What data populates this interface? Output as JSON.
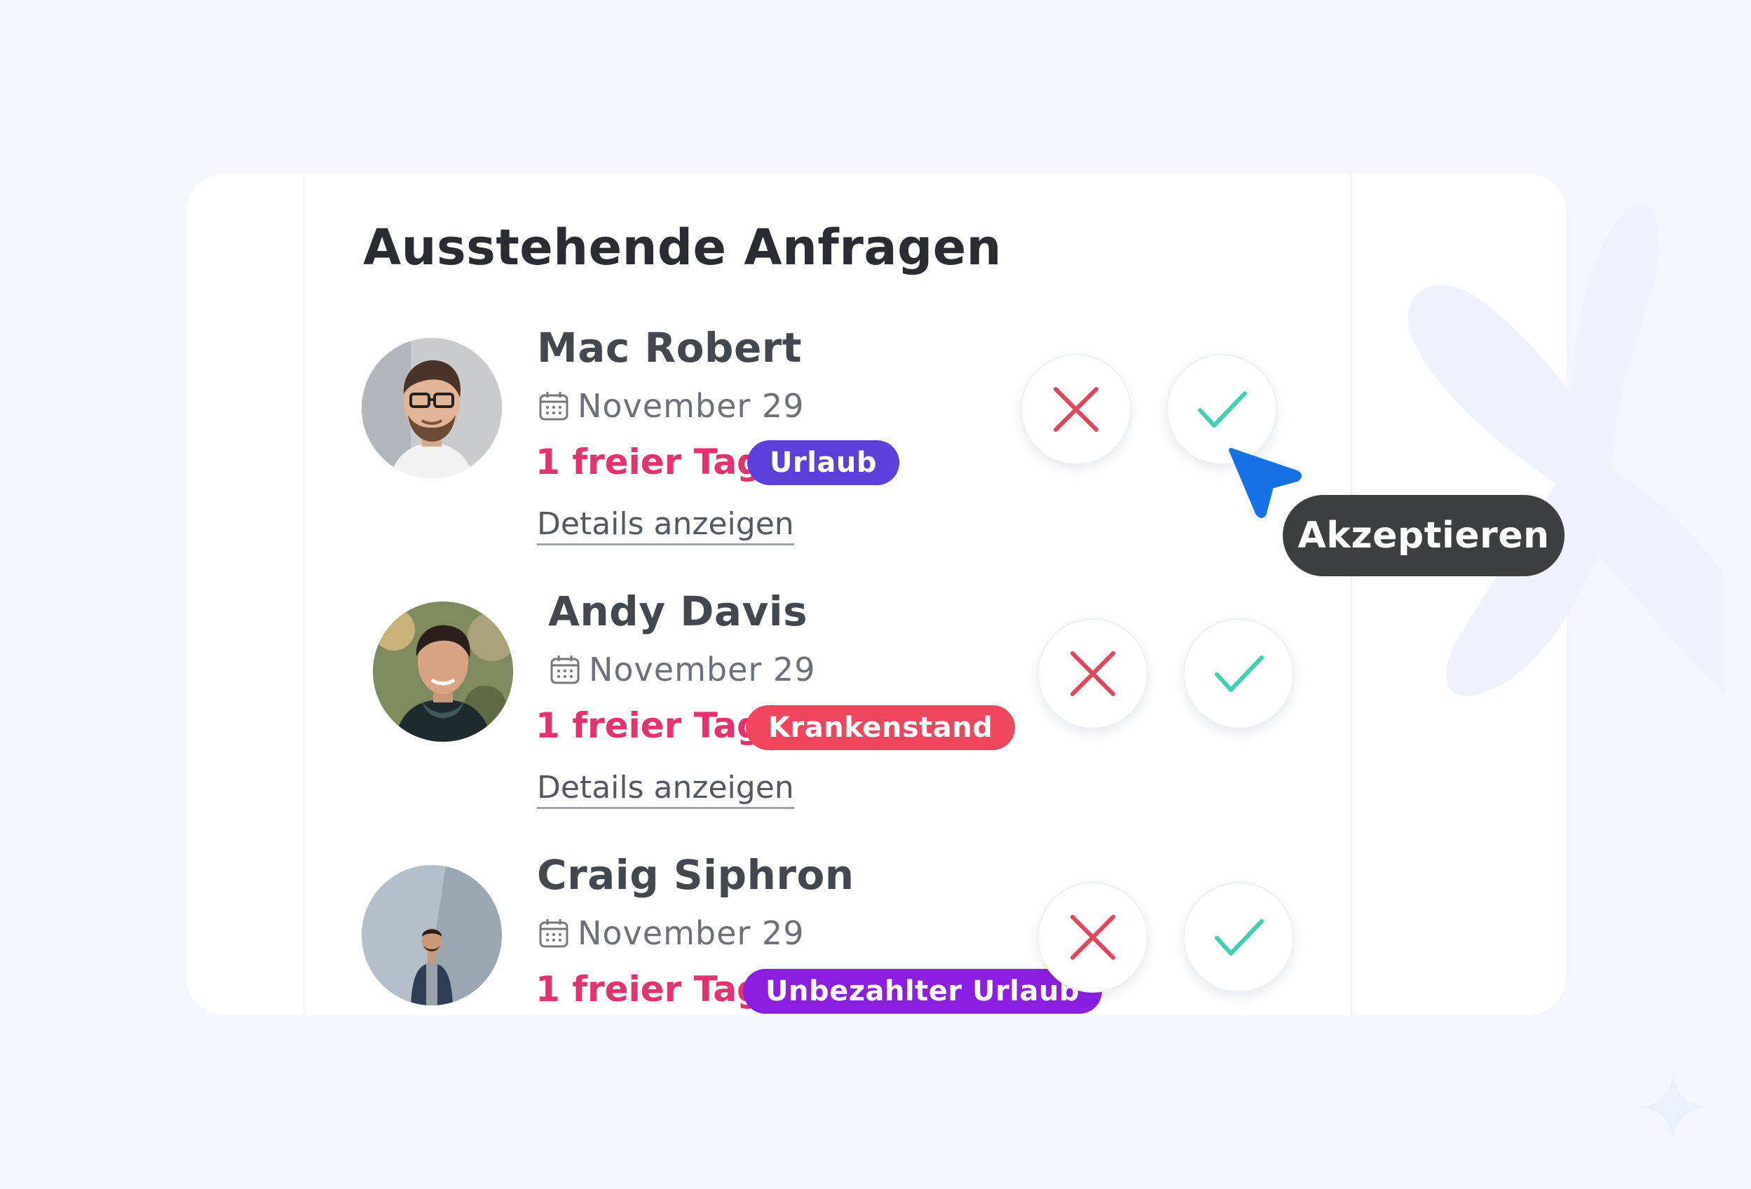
{
  "colors": {
    "page_background": "#f3f7fd",
    "card_background": "#ffffff",
    "title": "#2b2c31",
    "days": "#e3326e",
    "reject": "#e0475e",
    "accept": "#3fd0b0",
    "tooltip": "#3d3e40",
    "cursor": "#1671e6"
  },
  "panel": {
    "title": "Ausstehende Anfragen"
  },
  "requests": [
    {
      "name": "Mac Robert",
      "date": "November 29",
      "days": "1 freier Tag",
      "badge": {
        "label": "Urlaub",
        "color": "#5b3fd9"
      },
      "details": "Details anzeigen",
      "avatar": "avatar-photo-man-glasses"
    },
    {
      "name": "Andy Davis",
      "date": "November 29",
      "days": "1 freier Tag",
      "badge": {
        "label": "Krankenstand",
        "color": "#f0455f"
      },
      "details": "Details anzeigen",
      "avatar": "avatar-photo-man-scarf"
    },
    {
      "name": "Craig Siphron",
      "date": "November 29",
      "days": "1 freier Tag",
      "badge": {
        "label": "Unbezahlter Urlaub",
        "color": "#8b1ee0"
      },
      "avatar": "avatar-photo-man-wall"
    }
  ],
  "icons": {
    "date": "calendar-icon",
    "reject": "x-icon",
    "accept": "check-icon",
    "pointer": "cursor-arrow-icon"
  },
  "tooltip": {
    "label": "Akzeptieren"
  }
}
